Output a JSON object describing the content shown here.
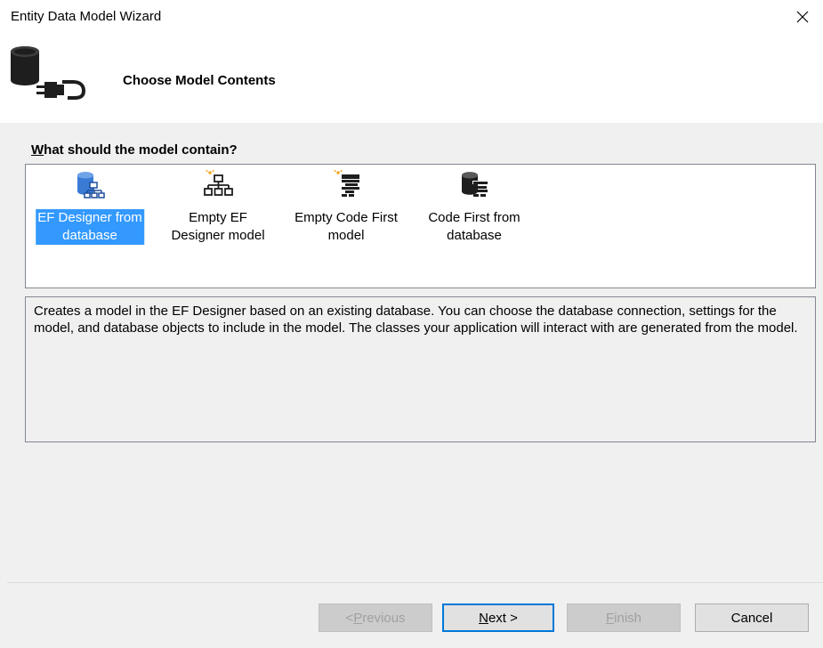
{
  "window": {
    "title": "Entity Data Model Wizard",
    "close_glyph": "✕"
  },
  "header": {
    "title": "Choose Model Contents",
    "icon": "database-plug-icon"
  },
  "section": {
    "label_mnemonic": "W",
    "label_rest": "hat should the model contain?"
  },
  "choices": [
    {
      "line1": "EF Designer from",
      "line2": "database",
      "icon": "ef-designer-database-icon",
      "selected": true
    },
    {
      "line1": "Empty EF",
      "line2": "Designer model",
      "icon": "empty-ef-designer-icon",
      "selected": false
    },
    {
      "line1": "Empty Code First",
      "line2": "model",
      "icon": "empty-code-first-icon",
      "selected": false
    },
    {
      "line1": "Code First from",
      "line2": "database",
      "icon": "code-first-database-icon",
      "selected": false
    }
  ],
  "description": "Creates a model in the EF Designer based on an existing database. You can choose the database connection, settings for the model, and database objects to include in the model. The classes your application will interact with are generated from the model.",
  "buttons": {
    "previous": {
      "prefix": "< ",
      "mnemonic": "P",
      "rest": "revious",
      "enabled": false
    },
    "next": {
      "mnemonic": "N",
      "rest": "ext >",
      "enabled": true
    },
    "finish": {
      "mnemonic": "F",
      "rest": "inish",
      "enabled": false
    },
    "cancel": {
      "label": "Cancel",
      "enabled": true
    }
  },
  "colors": {
    "selection": "#3399ff",
    "default_button_border": "#0078d7",
    "dialog_background": "#f0f0f0"
  }
}
